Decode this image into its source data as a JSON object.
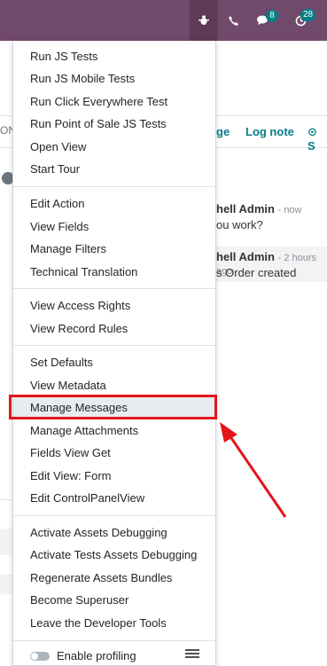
{
  "navbar": {
    "debug_icon": "bug-icon",
    "phone_icon": "phone-icon",
    "chat_icon": "chat-icon",
    "chat_count": "8",
    "activity_icon": "clock-icon",
    "activity_count": "28",
    "color": "#71496a"
  },
  "background": {
    "left_fragment": "ON",
    "tabs": [
      "ge",
      "Log note",
      "S"
    ],
    "messages": [
      {
        "author": "hell Admin",
        "time": "- now",
        "body": "ou work?"
      },
      {
        "author": "hell Admin",
        "time": "- 2 hours ago",
        "body": "s Order created"
      }
    ]
  },
  "debug_menu": {
    "groups": [
      [
        "Run JS Tests",
        "Run JS Mobile Tests",
        "Run Click Everywhere Test",
        "Run Point of Sale JS Tests",
        "Open View",
        "Start Tour"
      ],
      [
        "Edit Action",
        "View Fields",
        "Manage Filters",
        "Technical Translation"
      ],
      [
        "View Access Rights",
        "View Record Rules"
      ],
      [
        "Set Defaults",
        "View Metadata",
        "Manage Messages",
        "Manage Attachments",
        "Fields View Get",
        "Edit View: Form",
        "Edit ControlPanelView"
      ],
      [
        "Activate Assets Debugging",
        "Activate Tests Assets Debugging",
        "Regenerate Assets Bundles",
        "Become Superuser",
        "Leave the Developer Tools"
      ]
    ],
    "highlighted": "Manage Messages",
    "profiling_label": "Enable profiling"
  },
  "annotation": {
    "color": "#e3151a"
  }
}
